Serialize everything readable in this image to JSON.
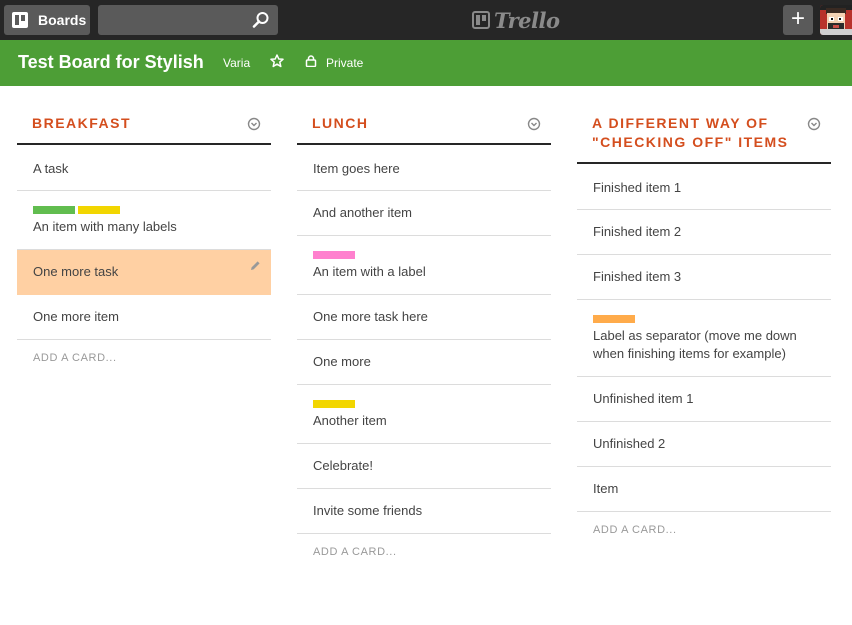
{
  "header": {
    "boards_label": "Boards",
    "search_value": "",
    "logo_text": "Trello",
    "add_label": "+"
  },
  "board": {
    "title": "Test Board for Stylish",
    "organization": "Varia",
    "privacy": "Private"
  },
  "colors": {
    "header_bg": "#262626",
    "board_bar_bg": "#4d9e36",
    "list_title": "#d44e1e",
    "active_card_bg": "#ffd0a3",
    "label_green": "#61bd4f",
    "label_yellow": "#f2d600",
    "label_pink": "#ff80ce",
    "label_orange": "#ffab4a"
  },
  "lists": [
    {
      "title": "Breakfast",
      "add_card": "ADD A CARD...",
      "cards": [
        {
          "text": "A task"
        },
        {
          "text": "An item with many labels",
          "labels": [
            "green",
            "yellow"
          ]
        },
        {
          "text": "One more task",
          "active": true
        },
        {
          "text": "One more item"
        }
      ]
    },
    {
      "title": "Lunch",
      "add_card": "ADD A CARD...",
      "cards": [
        {
          "text": "Item goes here"
        },
        {
          "text": "And another item"
        },
        {
          "text": "An item with a label",
          "labels": [
            "pink"
          ]
        },
        {
          "text": "One more task here"
        },
        {
          "text": "One more"
        },
        {
          "text": "Another item",
          "labels": [
            "yellow"
          ]
        },
        {
          "text": "Celebrate!"
        },
        {
          "text": "Invite some friends"
        }
      ]
    },
    {
      "title": "A different way of \"checking off\" items",
      "add_card": "ADD A CARD...",
      "cards": [
        {
          "text": "Finished item 1"
        },
        {
          "text": "Finished item 2"
        },
        {
          "text": "Finished item 3"
        },
        {
          "text": "Label as separator (move me down when finishing items for example)",
          "labels": [
            "orange"
          ]
        },
        {
          "text": "Unfinished item 1"
        },
        {
          "text": "Unfinished 2"
        },
        {
          "text": "Item"
        }
      ]
    }
  ]
}
